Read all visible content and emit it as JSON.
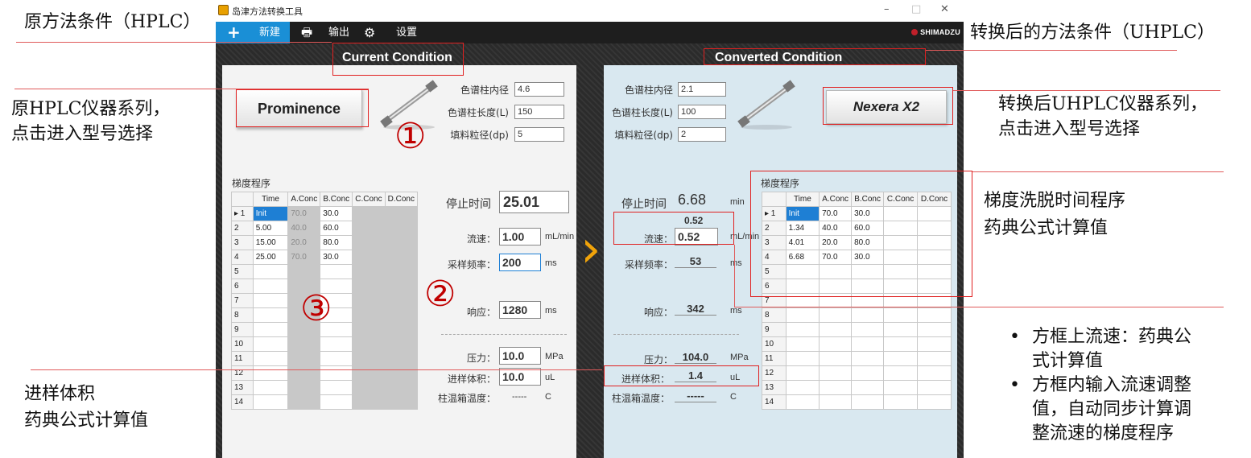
{
  "annotations": {
    "original_condition": "原方法条件（HPLC）",
    "converted_condition": "转换后的方法条件（UHPLC）",
    "orig_series_1": "原HPLC仪器系列，",
    "orig_series_2": "点击进入型号选择",
    "conv_series_1": "转换后UHPLC仪器系列，",
    "conv_series_2": "点击进入型号选择",
    "gradient_1": "梯度洗脱时间程序",
    "gradient_2": "药典公式计算值",
    "inj_vol_1": "进样体积",
    "inj_vol_2": "药典公式计算值",
    "bullet_1a": "方框上流速：药典公",
    "bullet_1b": "式计算值",
    "bullet_2a": "方框内输入流速调整",
    "bullet_2b": "值，自动同步计算调",
    "bullet_2c": "整流速的梯度程序",
    "circle_1": "①",
    "circle_2": "②",
    "circle_3": "③"
  },
  "window": {
    "title": "岛津方法转换工具",
    "minimize": "–",
    "maximize": "□",
    "close": "✕"
  },
  "toolbar": {
    "add_glyph": "+",
    "new_label": "新建",
    "print_glyph": "🖶",
    "output_label": "输出",
    "settings_glyph": "⚙",
    "settings_label": "设置",
    "brand": "SHIMADZU"
  },
  "current": {
    "header": "Current Condition",
    "series_button": "Prominence",
    "col_id_label": "色谱柱内径",
    "col_id": "4.6",
    "col_len_label": "色谱柱长度(L)",
    "col_len": "150",
    "particle_label": "填料粒径(dp)",
    "particle": "5",
    "gradient_label": "梯度程序",
    "stop_time_label": "停止时间",
    "stop_time": "25.01",
    "flow_label": "流速：",
    "flow": "1.00",
    "flow_unit": "mL/min",
    "sampling_label": "采样频率：",
    "sampling": "200",
    "sampling_unit": "ms",
    "response_label": "响应：",
    "response": "1280",
    "response_unit": "ms",
    "pressure_label": "压力：",
    "pressure": "10.0",
    "pressure_unit": "MPa",
    "inj_label": "进样体积：",
    "inj": "10.0",
    "inj_unit": "uL",
    "oven_label": "柱温箱温度：",
    "oven": "-----",
    "oven_unit": "C"
  },
  "converted": {
    "header": "Converted Condition",
    "series_button": "Nexera X2",
    "col_id_label": "色谱柱内径",
    "col_id": "2.1",
    "col_len_label": "色谱柱长度(L)",
    "col_len": "100",
    "particle_label": "填料粒径(dp)",
    "particle": "2",
    "gradient_label": "梯度程序",
    "stop_time_label": "停止时间",
    "stop_time": "6.68",
    "stop_time_unit": "min",
    "flow_calc": "0.52",
    "flow_label": "流速：",
    "flow": "0.52",
    "flow_unit": "mL/min",
    "sampling_label": "采样频率：",
    "sampling": "53",
    "sampling_unit": "ms",
    "response_label": "响应：",
    "response": "342",
    "response_unit": "ms",
    "pressure_label": "压力：",
    "pressure": "104.0",
    "pressure_unit": "MPa",
    "inj_label": "进样体积：",
    "inj": "1.4",
    "inj_unit": "uL",
    "oven_label": "柱温箱温度：",
    "oven": "-----",
    "oven_unit": "C"
  },
  "grid_headers": [
    "Time",
    "A.Conc",
    "B.Conc",
    "C.Conc",
    "D.Conc"
  ],
  "grid_left_rows": [
    {
      "n": "▸ 1",
      "time": "Init",
      "a": "70.0",
      "b": "30.0"
    },
    {
      "n": "2",
      "time": "5.00",
      "a": "40.0",
      "b": "60.0"
    },
    {
      "n": "3",
      "time": "15.00",
      "a": "20.0",
      "b": "80.0"
    },
    {
      "n": "4",
      "time": "25.00",
      "a": "70.0",
      "b": "30.0"
    },
    {
      "n": "5",
      "time": "",
      "a": "",
      "b": ""
    },
    {
      "n": "6",
      "time": "",
      "a": "",
      "b": ""
    },
    {
      "n": "7",
      "time": "",
      "a": "",
      "b": ""
    },
    {
      "n": "8",
      "time": "",
      "a": "",
      "b": ""
    },
    {
      "n": "9",
      "time": "",
      "a": "",
      "b": ""
    },
    {
      "n": "10",
      "time": "",
      "a": "",
      "b": ""
    },
    {
      "n": "11",
      "time": "",
      "a": "",
      "b": ""
    },
    {
      "n": "12",
      "time": "",
      "a": "",
      "b": ""
    },
    {
      "n": "13",
      "time": "",
      "a": "",
      "b": ""
    },
    {
      "n": "14",
      "time": "",
      "a": "",
      "b": ""
    }
  ],
  "grid_right_rows": [
    {
      "n": "▸ 1",
      "time": "Init",
      "a": "70.0",
      "b": "30.0"
    },
    {
      "n": "2",
      "time": "1.34",
      "a": "40.0",
      "b": "60.0"
    },
    {
      "n": "3",
      "time": "4.01",
      "a": "20.0",
      "b": "80.0"
    },
    {
      "n": "4",
      "time": "6.68",
      "a": "70.0",
      "b": "30.0"
    },
    {
      "n": "5",
      "time": "",
      "a": "",
      "b": ""
    },
    {
      "n": "6",
      "time": "",
      "a": "",
      "b": ""
    },
    {
      "n": "7",
      "time": "",
      "a": "",
      "b": ""
    },
    {
      "n": "8",
      "time": "",
      "a": "",
      "b": ""
    },
    {
      "n": "9",
      "time": "",
      "a": "",
      "b": ""
    },
    {
      "n": "10",
      "time": "",
      "a": "",
      "b": ""
    },
    {
      "n": "11",
      "time": "",
      "a": "",
      "b": ""
    },
    {
      "n": "12",
      "time": "",
      "a": "",
      "b": ""
    },
    {
      "n": "13",
      "time": "",
      "a": "",
      "b": ""
    },
    {
      "n": "14",
      "time": "",
      "a": "",
      "b": ""
    }
  ],
  "colors": {
    "accent": "#1a8fd6",
    "chevron": "#f0a30a",
    "annotation_red": "#c00000"
  }
}
